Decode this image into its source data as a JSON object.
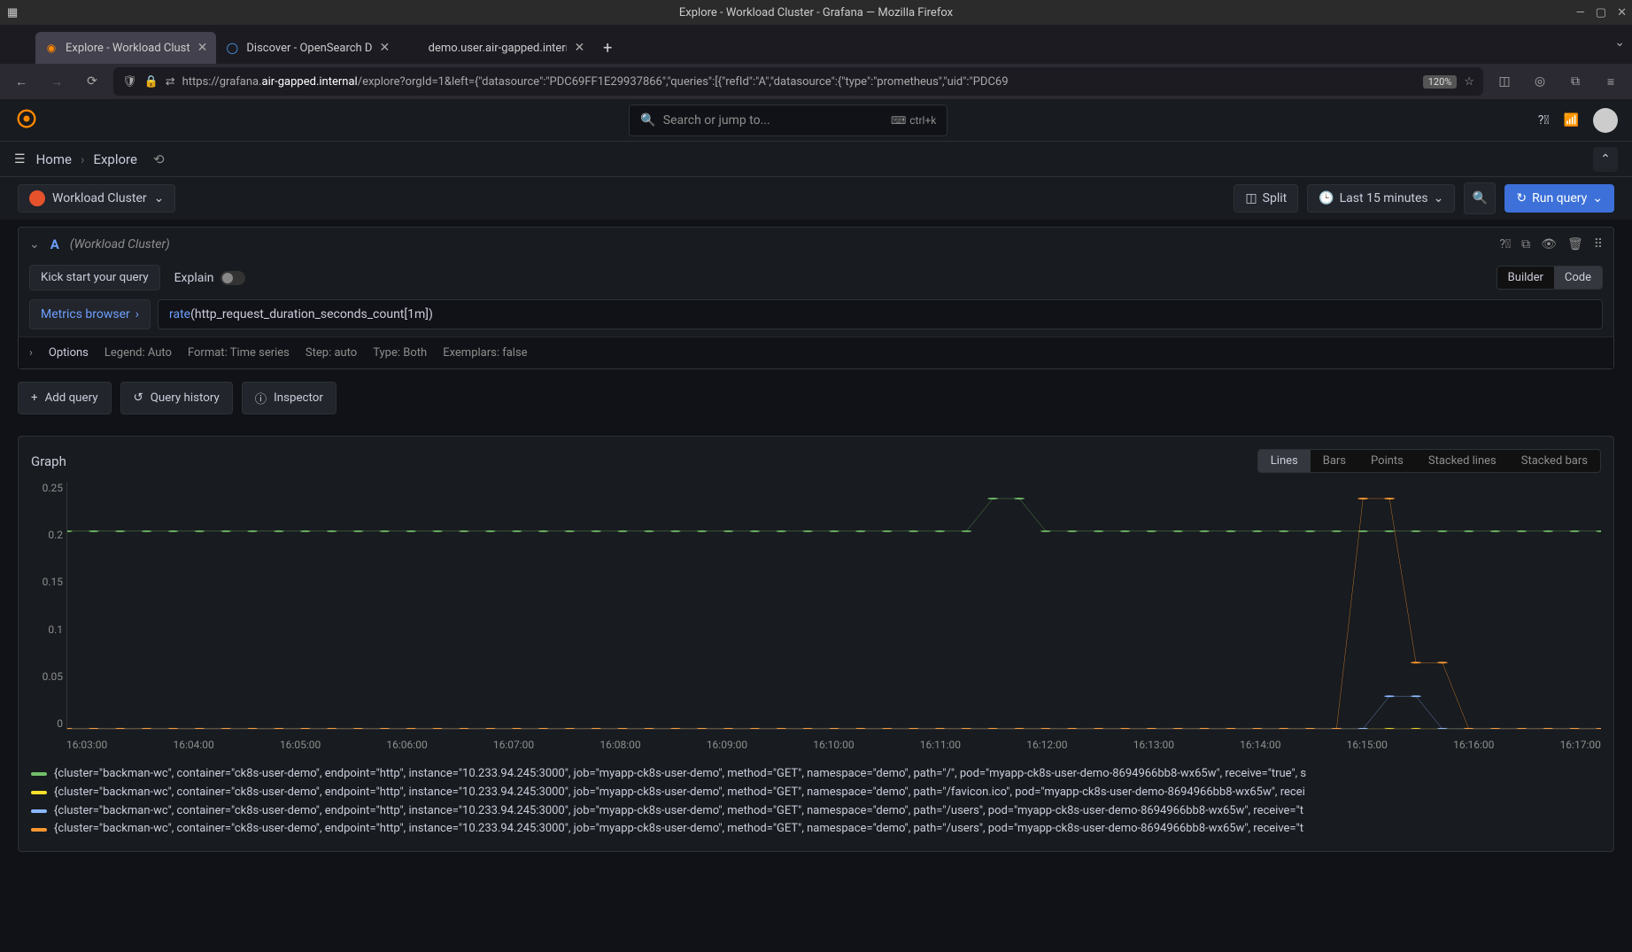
{
  "titlebar": {
    "title": "Explore - Workload Cluster - Grafana — Mozilla Firefox"
  },
  "tabs": [
    {
      "label": "Explore - Workload Clust",
      "active": true,
      "favicon": "grafana"
    },
    {
      "label": "Discover - OpenSearch D",
      "active": false,
      "favicon": "opensearch"
    },
    {
      "label": "demo.user.air-gapped.intern",
      "active": false,
      "favicon": "none"
    }
  ],
  "url": {
    "prefix": "https://grafana.",
    "highlight": "air-gapped.internal",
    "suffix": "/explore?orgId=1&left={\"datasource\":\"PDC69FF1E29937866\",\"queries\":[{\"refId\":\"A\",\"datasource\":{\"type\":\"prometheus\",\"uid\":\"PDC69",
    "zoom": "120%"
  },
  "search": {
    "placeholder": "Search or jump to...",
    "shortcut": "ctrl+k"
  },
  "breadcrumb": {
    "home": "Home",
    "explore": "Explore"
  },
  "toolbar": {
    "datasource": "Workload Cluster",
    "split": "Split",
    "timerange": "Last 15 minutes",
    "run": "Run query"
  },
  "query": {
    "id": "A",
    "ds_hint": "(Workload Cluster)",
    "kick": "Kick start your query",
    "explain": "Explain",
    "builder": "Builder",
    "code": "Code",
    "metrics_browser": "Metrics browser",
    "code_fn": "rate",
    "code_rest": "(http_request_duration_seconds_count[1m])",
    "options": {
      "label": "Options",
      "legend": "Legend: Auto",
      "format": "Format: Time series",
      "step": "Step: auto",
      "type": "Type: Both",
      "exemplars": "Exemplars: false"
    }
  },
  "actions": {
    "add": "Add query",
    "history": "Query history",
    "inspector": "Inspector"
  },
  "graph": {
    "title": "Graph",
    "viz": [
      "Lines",
      "Bars",
      "Points",
      "Stacked lines",
      "Stacked bars"
    ],
    "viz_active": "Lines"
  },
  "legend_items": [
    {
      "color": "#73bf69",
      "text": "{cluster=\"backman-wc\", container=\"ck8s-user-demo\", endpoint=\"http\", instance=\"10.233.94.245:3000\", job=\"myapp-ck8s-user-demo\", method=\"GET\", namespace=\"demo\", path=\"/\", pod=\"myapp-ck8s-user-demo-8694966bb8-wx65w\", receive=\"true\", s"
    },
    {
      "color": "#fade2a",
      "text": "{cluster=\"backman-wc\", container=\"ck8s-user-demo\", endpoint=\"http\", instance=\"10.233.94.245:3000\", job=\"myapp-ck8s-user-demo\", method=\"GET\", namespace=\"demo\", path=\"/favicon.ico\", pod=\"myapp-ck8s-user-demo-8694966bb8-wx65w\", recei"
    },
    {
      "color": "#8ab8ff",
      "text": "{cluster=\"backman-wc\", container=\"ck8s-user-demo\", endpoint=\"http\", instance=\"10.233.94.245:3000\", job=\"myapp-ck8s-user-demo\", method=\"GET\", namespace=\"demo\", path=\"/users\", pod=\"myapp-ck8s-user-demo-8694966bb8-wx65w\", receive=\"t"
    },
    {
      "color": "#ff9830",
      "text": "{cluster=\"backman-wc\", container=\"ck8s-user-demo\", endpoint=\"http\", instance=\"10.233.94.245:3000\", job=\"myapp-ck8s-user-demo\", method=\"GET\", namespace=\"demo\", path=\"/users\", pod=\"myapp-ck8s-user-demo-8694966bb8-wx65w\", receive=\"t"
    }
  ],
  "chart_data": {
    "type": "line",
    "xlabel": "",
    "ylabel": "",
    "ylim": [
      0,
      0.25
    ],
    "y_ticks": [
      0,
      0.05,
      0.1,
      0.15,
      0.2,
      0.25
    ],
    "x_ticks": [
      "16:03:00",
      "16:04:00",
      "16:05:00",
      "16:06:00",
      "16:07:00",
      "16:08:00",
      "16:09:00",
      "16:10:00",
      "16:11:00",
      "16:12:00",
      "16:13:00",
      "16:14:00",
      "16:15:00",
      "16:16:00",
      "16:17:00"
    ],
    "x": [
      "16:03:00",
      "16:03:15",
      "16:03:30",
      "16:03:45",
      "16:04:00",
      "16:04:15",
      "16:04:30",
      "16:04:45",
      "16:05:00",
      "16:05:15",
      "16:05:30",
      "16:05:45",
      "16:06:00",
      "16:06:15",
      "16:06:30",
      "16:06:45",
      "16:07:00",
      "16:07:15",
      "16:07:30",
      "16:07:45",
      "16:08:00",
      "16:08:15",
      "16:08:30",
      "16:08:45",
      "16:09:00",
      "16:09:15",
      "16:09:30",
      "16:09:45",
      "16:10:00",
      "16:10:15",
      "16:10:30",
      "16:10:45",
      "16:11:00",
      "16:11:15",
      "16:11:30",
      "16:11:45",
      "16:12:00",
      "16:12:15",
      "16:12:30",
      "16:12:45",
      "16:13:00",
      "16:13:15",
      "16:13:30",
      "16:13:45",
      "16:14:00",
      "16:14:15",
      "16:14:30",
      "16:14:45",
      "16:15:00",
      "16:15:15",
      "16:15:30",
      "16:15:45",
      "16:16:00",
      "16:16:15",
      "16:16:30",
      "16:16:45",
      "16:17:00",
      "16:17:15",
      "16:17:30"
    ],
    "series": [
      {
        "name": "path=\"/\"",
        "color": "#73bf69",
        "values": [
          0.2,
          0.2,
          0.2,
          0.2,
          0.2,
          0.2,
          0.2,
          0.2,
          0.2,
          0.2,
          0.2,
          0.2,
          0.2,
          0.2,
          0.2,
          0.2,
          0.2,
          0.2,
          0.2,
          0.2,
          0.2,
          0.2,
          0.2,
          0.2,
          0.2,
          0.2,
          0.2,
          0.2,
          0.2,
          0.2,
          0.2,
          0.2,
          0.2,
          0.2,
          0.2,
          0.233,
          0.233,
          0.2,
          0.2,
          0.2,
          0.2,
          0.2,
          0.2,
          0.2,
          0.2,
          0.2,
          0.2,
          0.2,
          0.2,
          0.2,
          0.2,
          0.2,
          0.2,
          0.2,
          0.2,
          0.2,
          0.2,
          0.2,
          0.2
        ]
      },
      {
        "name": "path=\"/favicon.ico\"",
        "color": "#fade2a",
        "values": [
          0,
          0,
          0,
          0,
          0,
          0,
          0,
          0,
          0,
          0,
          0,
          0,
          0,
          0,
          0,
          0,
          0,
          0,
          0,
          0,
          0,
          0,
          0,
          0,
          0,
          0,
          0,
          0,
          0,
          0,
          0,
          0,
          0,
          0,
          0,
          0,
          0,
          0,
          0,
          0,
          0,
          0,
          0,
          0,
          0,
          0,
          0,
          0,
          0,
          0,
          0,
          0,
          0,
          0,
          0,
          0,
          0,
          0,
          0
        ]
      },
      {
        "name": "path=\"/users\" (blue)",
        "color": "#8ab8ff",
        "values": [
          0,
          0,
          0,
          0,
          0,
          0,
          0,
          0,
          0,
          0,
          0,
          0,
          0,
          0,
          0,
          0,
          0,
          0,
          0,
          0,
          0,
          0,
          0,
          0,
          0,
          0,
          0,
          0,
          0,
          0,
          0,
          0,
          0,
          0,
          0,
          0,
          0,
          0,
          0,
          0,
          0,
          0,
          0,
          0,
          0,
          0,
          0,
          0,
          0,
          0,
          0.033,
          0.033,
          0,
          0,
          0,
          0,
          0,
          0,
          0
        ]
      },
      {
        "name": "path=\"/users\" (orange)",
        "color": "#ff9830",
        "values": [
          0,
          0,
          0,
          0,
          0,
          0,
          0,
          0,
          0,
          0,
          0,
          0,
          0,
          0,
          0,
          0,
          0,
          0,
          0,
          0,
          0,
          0,
          0,
          0,
          0,
          0,
          0,
          0,
          0,
          0,
          0,
          0,
          0,
          0,
          0,
          0,
          0,
          0,
          0,
          0,
          0,
          0,
          0,
          0,
          0,
          0,
          0,
          0,
          0,
          0.233,
          0.233,
          0.067,
          0.067,
          0,
          0,
          0,
          0,
          0,
          0
        ]
      }
    ]
  }
}
